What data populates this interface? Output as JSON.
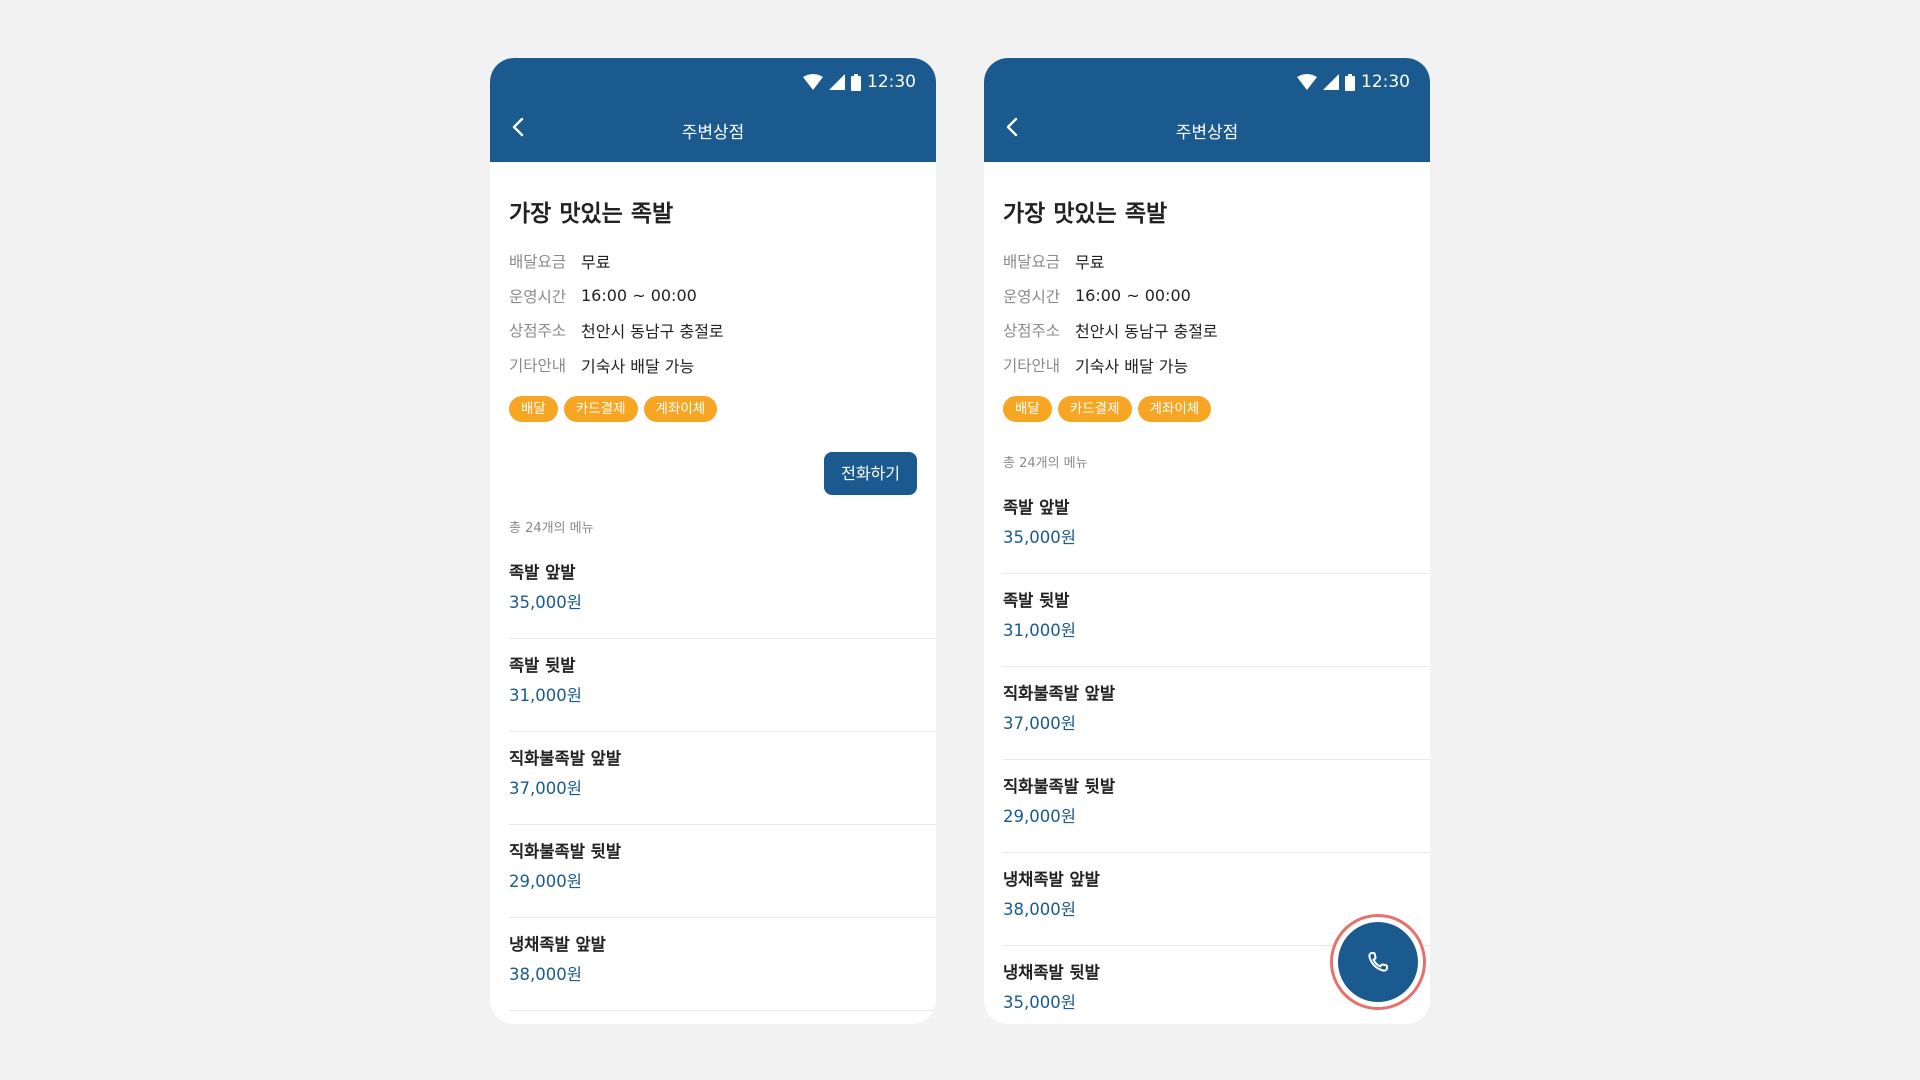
{
  "status": {
    "time": "12:30"
  },
  "appbar": {
    "title": "주변상점"
  },
  "shop": {
    "name": "가장 맛있는 족발",
    "info": [
      {
        "label": "배달요금",
        "value": "무료"
      },
      {
        "label": "운영시간",
        "value": "16:00 ~ 00:00"
      },
      {
        "label": "상점주소",
        "value": "천안시 동남구 충절로"
      },
      {
        "label": "기타안내",
        "value": "기숙사 배달 가능"
      }
    ],
    "tags": [
      "배달",
      "카드결제",
      "계좌이체"
    ]
  },
  "call_button_label": "전화하기",
  "menu": {
    "count_label": "총 24개의 메뉴",
    "items": [
      {
        "name": "족발 앞발",
        "price": "35,000원"
      },
      {
        "name": "족발 뒷발",
        "price": "31,000원"
      },
      {
        "name": "직화불족발 앞발",
        "price": "37,000원"
      },
      {
        "name": "직화불족발 뒷발",
        "price": "29,000원"
      },
      {
        "name": "냉채족발 앞발",
        "price": "38,000원"
      },
      {
        "name": "냉채족발 뒷발",
        "price": "35,000원"
      }
    ]
  },
  "icons": {
    "back": "chevron-left-icon",
    "wifi": "wifi-icon",
    "signal": "signal-icon",
    "battery": "battery-icon",
    "fab": "phone-icon"
  },
  "colors": {
    "primary": "#1a5a8e",
    "tag": "#f6a623",
    "highlight_ring": "#e8706a"
  }
}
